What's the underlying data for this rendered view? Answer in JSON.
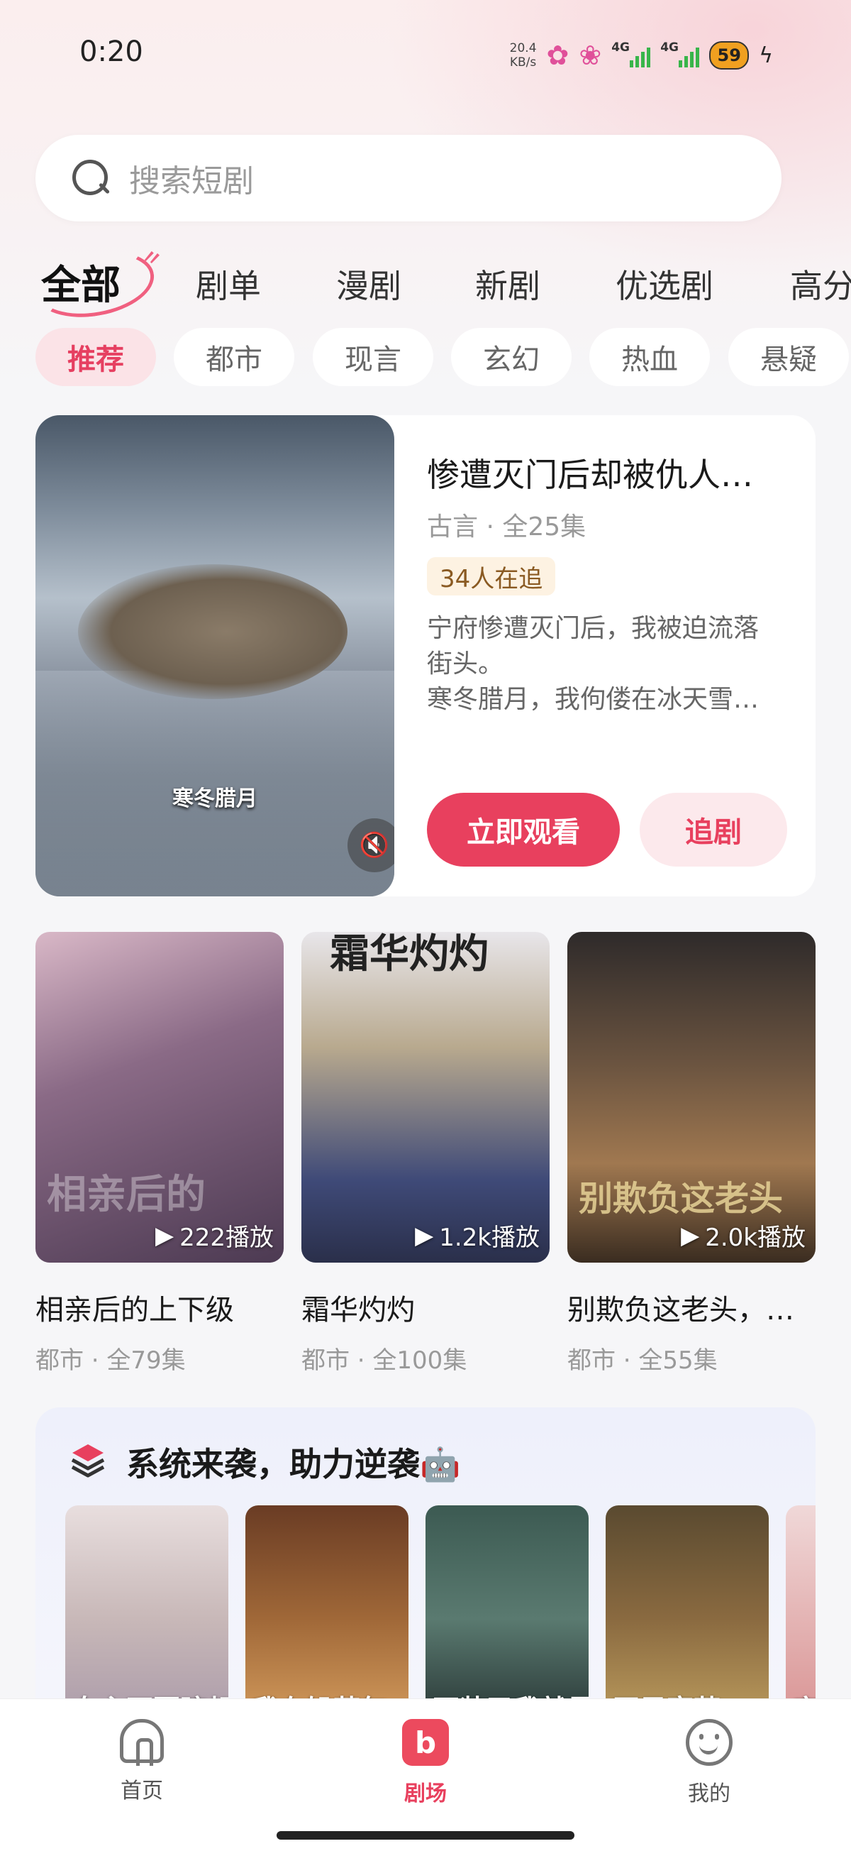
{
  "status_bar": {
    "time": "0:20",
    "net_speed": "20.4",
    "net_unit": "KB/s",
    "network_1": "4G",
    "network_2": "4G",
    "battery": "59"
  },
  "search": {
    "placeholder": "搜索短剧"
  },
  "category_tabs": [
    "全部",
    "剧单",
    "漫剧",
    "新剧",
    "优选剧",
    "高分"
  ],
  "genre_chips": [
    "推荐",
    "都市",
    "现言",
    "玄幻",
    "热血",
    "悬疑"
  ],
  "featured": {
    "title": "惨遭灭门后却被仇人…",
    "meta": "古言 · 全25集",
    "badge": "34人在追",
    "desc_line1": "宁府惨遭灭门后，我被迫流落",
    "desc_line2": "街头。",
    "desc_line3": "寒冬腊月，我佝偻在冰天雪…",
    "poster_caption": "寒冬腊月",
    "watch_label": "立即观看",
    "follow_label": "追剧"
  },
  "dramas": [
    {
      "title": "相亲后的上下级",
      "meta": "都市 · 全79集",
      "plays": "222播放",
      "poster_text": "相亲后的"
    },
    {
      "title": "霜华灼灼",
      "meta": "都市 · 全100集",
      "plays": "1.2k播放",
      "poster_text": "霜华灼灼"
    },
    {
      "title": "别欺负这老头，…",
      "meta": "都市 · 全55集",
      "plays": "2.0k播放",
      "poster_text": "别欺负这老头"
    }
  ],
  "section": {
    "title": "系统来袭，助力逆袭🤖",
    "posters": [
      "女主不要瞎想",
      "我在饥荒年",
      "不装了我就是",
      "开局蛮荒",
      "穿"
    ]
  },
  "bottom_nav": [
    {
      "label": "首页",
      "icon": "home-icon"
    },
    {
      "label": "剧场",
      "icon": "theater-icon"
    },
    {
      "label": "我的",
      "icon": "profile-icon"
    }
  ],
  "colors": {
    "accent": "#e8405e",
    "chip_active_bg": "#fbe3e7",
    "badge_bg": "#fdf2e2"
  }
}
